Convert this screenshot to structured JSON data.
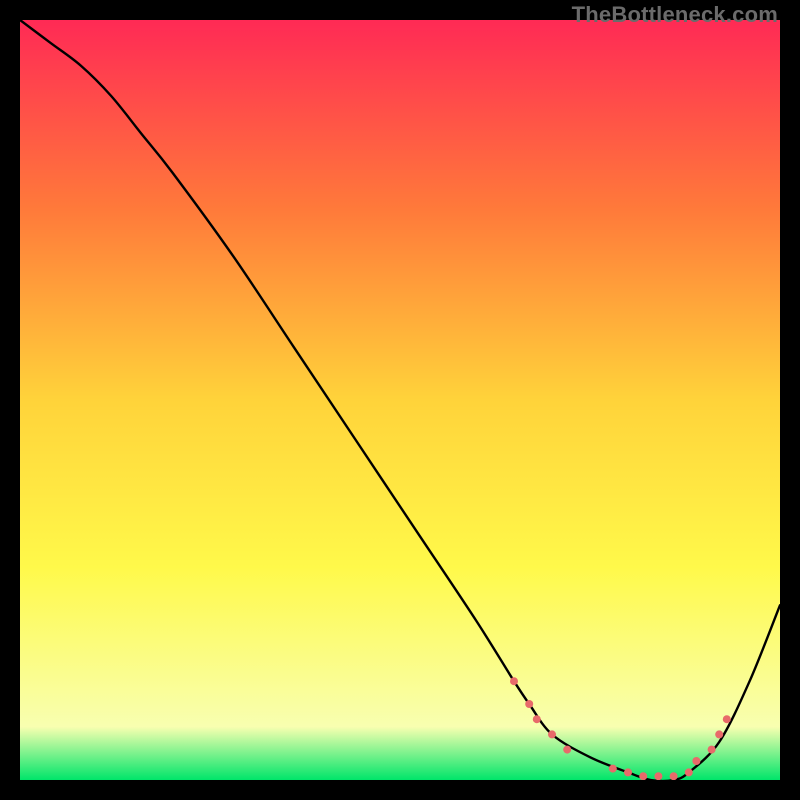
{
  "watermark": "TheBottleneck.com",
  "chart_data": {
    "type": "line",
    "title": "",
    "xlabel": "",
    "ylabel": "",
    "xlim": [
      0,
      100
    ],
    "ylim": [
      0,
      100
    ],
    "grid": false,
    "legend": false,
    "background_gradient": {
      "top": "#ff2a55",
      "mid_upper": "#ff7a3a",
      "mid": "#ffd33a",
      "mid_lower": "#fff94a",
      "near_bottom": "#f8ffb0",
      "bottom": "#00e56a"
    },
    "series": [
      {
        "name": "bottleneck-curve",
        "color": "#000000",
        "x": [
          0,
          4,
          8,
          12,
          16,
          20,
          28,
          36,
          44,
          52,
          60,
          65,
          67,
          70,
          75,
          80,
          83,
          86,
          88,
          92,
          96,
          100
        ],
        "y": [
          100,
          97,
          94,
          90,
          85,
          80,
          69,
          57,
          45,
          33,
          21,
          13,
          10,
          6,
          3,
          1,
          0,
          0,
          1,
          5,
          13,
          23
        ]
      }
    ],
    "annotations": [
      {
        "name": "marker-cluster",
        "kind": "scatter",
        "color": "#e86a6a",
        "marker_size": 8,
        "points": [
          {
            "x": 65,
            "y": 13
          },
          {
            "x": 67,
            "y": 10
          },
          {
            "x": 68,
            "y": 8
          },
          {
            "x": 70,
            "y": 6
          },
          {
            "x": 72,
            "y": 4
          },
          {
            "x": 78,
            "y": 1.5
          },
          {
            "x": 80,
            "y": 1
          },
          {
            "x": 82,
            "y": 0.5
          },
          {
            "x": 84,
            "y": 0.5
          },
          {
            "x": 86,
            "y": 0.5
          },
          {
            "x": 88,
            "y": 1
          },
          {
            "x": 89,
            "y": 2.5
          },
          {
            "x": 91,
            "y": 4
          },
          {
            "x": 92,
            "y": 6
          },
          {
            "x": 93,
            "y": 8
          }
        ]
      }
    ]
  }
}
